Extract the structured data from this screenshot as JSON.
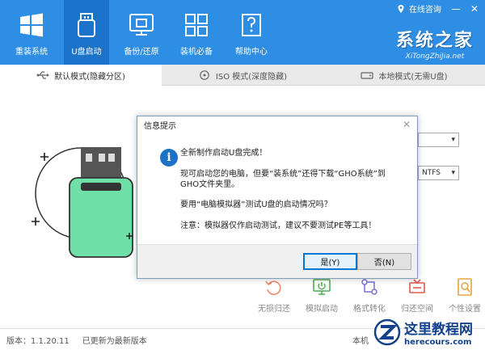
{
  "header": {
    "nav": [
      {
        "label": "重装系统",
        "icon": "windows-icon"
      },
      {
        "label": "U盘启动",
        "icon": "usb-drive-icon"
      },
      {
        "label": "备份/还原",
        "icon": "backup-icon"
      },
      {
        "label": "装机必备",
        "icon": "apps-icon"
      },
      {
        "label": "帮助中心",
        "icon": "help-icon"
      }
    ],
    "consult_label": "在线咨询",
    "minimize_glyph": "—",
    "close_glyph": "✕",
    "brand_name": "系统之家",
    "brand_url": "XiTongZhiJia.net"
  },
  "tabs": [
    {
      "label": "默认模式(隐藏分区)",
      "icon": "usb-icon"
    },
    {
      "label": "ISO 模式(深度隐藏)",
      "icon": "disc-icon"
    },
    {
      "label": "本地模式(无需U盘)",
      "icon": "drive-icon"
    }
  ],
  "main": {
    "filesystem_value": "NTFS",
    "tools": [
      {
        "label": "无损归还",
        "icon": "restore-icon"
      },
      {
        "label": "模拟启动",
        "icon": "simulate-boot-icon"
      },
      {
        "label": "格式转化",
        "icon": "format-convert-icon"
      },
      {
        "label": "归还空间",
        "icon": "reclaim-space-icon"
      },
      {
        "label": "个性设置",
        "icon": "settings-icon"
      }
    ]
  },
  "footer": {
    "version": "版本：1.1.20.11",
    "update": "已更新为最新版本",
    "right_text": "本机"
  },
  "dialog": {
    "title": "信息提示",
    "close_glyph": "✕",
    "line1": "全新制作启动U盘完成！",
    "line2": "现可启动您的电脑，但要“装系统”还得下载“GHO系统”到GHO文件夹里。",
    "line3": "要用“电脑模拟器”测试U盘的启动情况吗？",
    "line4": "注意：模拟器仅作启动测试，建议不要测试PE等工具！",
    "yes_label": "是(Y)",
    "no_label": "否(N)"
  },
  "watermark": {
    "cn": "这里教程网",
    "en": "herecours.com"
  },
  "colors": {
    "header_blue": "#2d8ee3",
    "active_nav": "#1b74c9",
    "usb_green": "#6fe0a8",
    "dialog_icon": "#1c72c4"
  }
}
